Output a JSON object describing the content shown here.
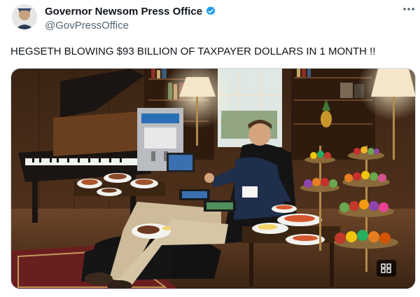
{
  "tweet": {
    "author": {
      "display_name": "Governor Newsom Press Office",
      "handle": "@GovPressOffice",
      "verified": true,
      "avatar_icon": "profile-avatar"
    },
    "more_icon": "more-options-icon",
    "text": "HEGSETH BLOWING $93 BILLION OF TAXPAYER DOLLARS IN 1 MONTH !!",
    "media": {
      "alt_icon": "grid-icon"
    },
    "colors": {
      "verified_badge": "#1d9bf0",
      "handle": "#536471",
      "text": "#0f1419"
    }
  }
}
